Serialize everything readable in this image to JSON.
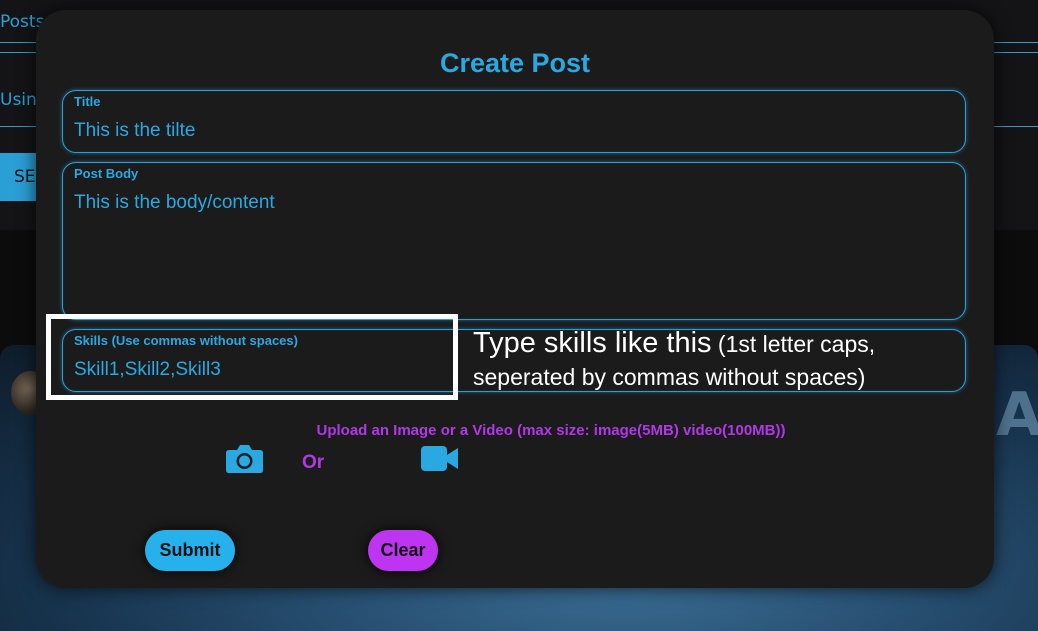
{
  "background": {
    "posts_label": "Posts",
    "using_label": "Using",
    "search_button_label": "SE",
    "hero_letter": "A"
  },
  "modal": {
    "title": "Create Post",
    "fields": {
      "title": {
        "label": "Title",
        "value": "This is the tilte"
      },
      "body": {
        "label": "Post Body",
        "value": "This is the body/content"
      },
      "skills": {
        "label": "Skills (Use commas without spaces)",
        "value": "Skill1,Skill2,Skill3"
      }
    },
    "annotation": {
      "main": "Type skills like this",
      "detail": "(1st letter caps,",
      "detail2": "seperated by commas without spaces)"
    },
    "upload_text": "Upload an Image or a Video (max size: image(5MB) video(100MB))",
    "or_text": "Or",
    "icons": {
      "image": "camera-icon",
      "video": "video-camera-icon"
    },
    "buttons": {
      "submit": "Submit",
      "clear": "Clear"
    },
    "colors": {
      "accent": "#2aa8e2",
      "purple": "#b138e6",
      "modal_bg": "#1b1b1c"
    }
  }
}
